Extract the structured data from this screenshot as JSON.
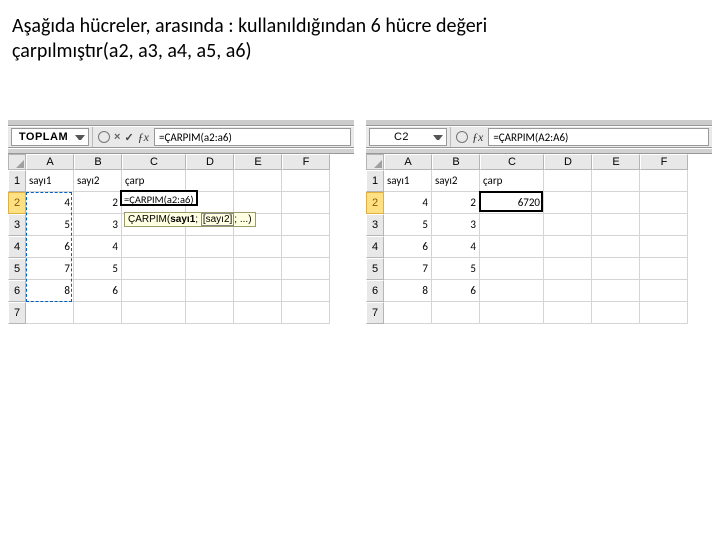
{
  "caption_line1": "Aşağıda hücreler, arasında : kullanıldığından 6 hücre değeri",
  "caption_line2": "çarpılmıştır(a2, a3, a4, a5, a6)",
  "columns": [
    "A",
    "B",
    "C",
    "D",
    "E",
    "F"
  ],
  "rows": [
    "1",
    "2",
    "3",
    "4",
    "5",
    "6",
    "7"
  ],
  "left": {
    "name_box": "TOPLAM",
    "formula": "=ÇARPIM(a2:a6)",
    "headers": {
      "A": "sayı1",
      "B": "sayı2",
      "C": "çarp"
    },
    "data": {
      "A": [
        "4",
        "5",
        "6",
        "7",
        "8"
      ],
      "B": [
        "2",
        "3",
        "4",
        "5",
        "6"
      ]
    },
    "editing": "=ÇARPIM(a2:a6)",
    "tooltip_fn": "ÇARPIM(",
    "tooltip_a1": "sayı1",
    "tooltip_a2": "[sayı2]",
    "tooltip_rest": "; ...)"
  },
  "right": {
    "name_box": "C2",
    "formula": "=ÇARPIM(A2:A6)",
    "headers": {
      "A": "sayı1",
      "B": "sayı2",
      "C": "çarp"
    },
    "data": {
      "A": [
        "4",
        "5",
        "6",
        "7",
        "8"
      ],
      "B": [
        "2",
        "3",
        "4",
        "5",
        "6"
      ]
    },
    "result": "6720"
  }
}
